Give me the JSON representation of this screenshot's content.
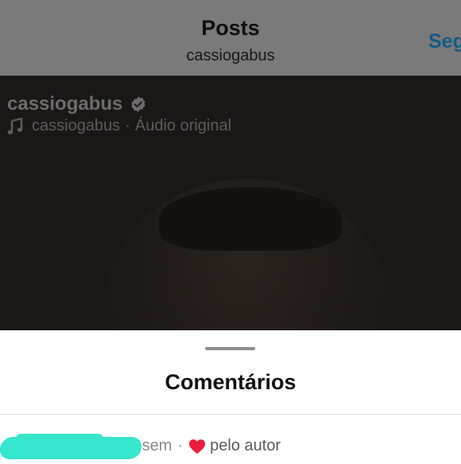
{
  "header": {
    "title": "Posts",
    "subtitle": "cassiogabus",
    "follow_label": "Seg"
  },
  "reel": {
    "username": "cassiogabus",
    "verified": true,
    "audio_owner": "cassiogabus",
    "audio_separator": "·",
    "audio_label": "Áudio original"
  },
  "comments_sheet": {
    "title": "Comentários",
    "first_comment": {
      "time_ago": "3 sem",
      "separator": "·",
      "liked_by_author_label": "pelo autor"
    }
  },
  "colors": {
    "follow_blue": "#145a86",
    "heart_red": "#ed1c3c",
    "redaction_teal": "#36e6cc"
  },
  "icons": [
    "verified-badge-icon",
    "music-note-icon",
    "heart-icon"
  ]
}
